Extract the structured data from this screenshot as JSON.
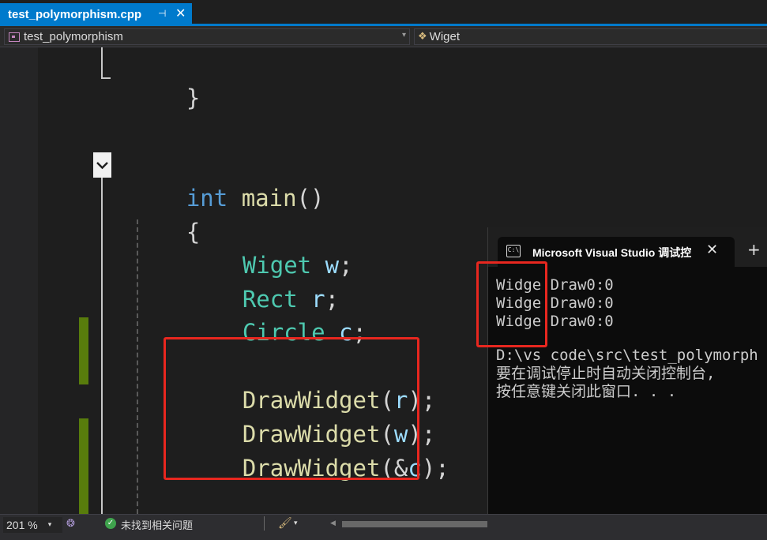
{
  "tab": {
    "title": "test_polymorphism.cpp",
    "pin_glyph": "⊣",
    "close_glyph": "✕"
  },
  "nav": {
    "scope": "test_polymorphism",
    "member": "Wiget",
    "dropdown_glyph": "▾"
  },
  "editor": {
    "lines": {
      "close_brace": "}",
      "main_kw": "int",
      "main_name": "main",
      "main_parens": "()",
      "open_brace": "{",
      "decl1_type": "Wiget",
      "decl1_var": "w",
      "decl1_end": ";",
      "decl2_type": "Rect",
      "decl2_var": "r",
      "decl2_end": ";",
      "decl3_type": "Circle",
      "decl3_var": "c",
      "decl3_end": ";",
      "call1_fn": "DrawWidget",
      "call1_open": "(",
      "call1_arg": "r",
      "call1_close": ");",
      "call2_fn": "DrawWidget",
      "call2_open": "(",
      "call2_arg": "w",
      "call2_close": ");",
      "call3_fn": "DrawWidget",
      "call3_open": "(&",
      "call3_arg": "c",
      "call3_close": ");"
    },
    "colors": {
      "keyword": "#569cd6",
      "type": "#4ec9b0",
      "variable": "#9cdcfe",
      "function": "#dcdcaa",
      "highlight_box": "#e8271f",
      "change_bar": "#587c0c"
    }
  },
  "console": {
    "title": "Microsoft Visual Studio 调试控",
    "close_glyph": "✕",
    "new_tab_glyph": "+",
    "icon_text": "C:\\",
    "output": [
      "Widge Draw0:0",
      "Widge Draw0:0",
      "Widge Draw0:0",
      "",
      "D:\\vs code\\src\\test_polymorph",
      "要在调试停止时自动关闭控制台,",
      "按任意键关闭此窗口. . ."
    ]
  },
  "status": {
    "zoom": "201 %",
    "zoom_arrow": "▾",
    "issues": "未找到相关问题",
    "check_glyph": "✓",
    "brush_glyph": "🖌",
    "brush_arrow": "▾",
    "scroll_left_glyph": "◀"
  }
}
